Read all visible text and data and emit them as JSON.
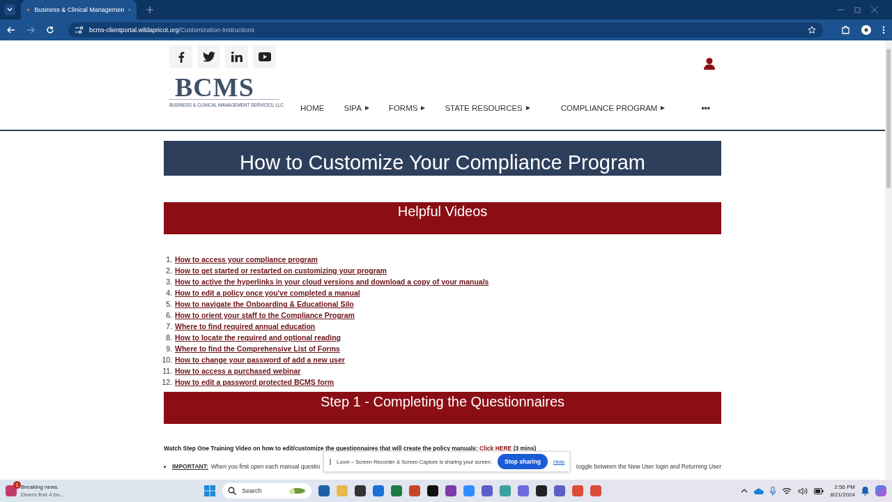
{
  "browser": {
    "tab_title": "Business & Clinical Managemen",
    "url_host": "bcms-clientportal.wildapricot.org",
    "url_path": "/Customization-Instructions"
  },
  "site": {
    "logo": "BCMS",
    "tagline": "BUSINESS & CLINICAL MANAGEMENT SERVICES, LLC",
    "nav": [
      {
        "label": "HOME",
        "submenu": false
      },
      {
        "label": "SIPA",
        "submenu": true
      },
      {
        "label": "FORMS",
        "submenu": true
      },
      {
        "label": "STATE RESOURCES",
        "submenu": true
      },
      {
        "label": "COMPLIANCE PROGRAM",
        "submenu": true
      }
    ],
    "more": "•••"
  },
  "page_title": "How to Customize Your Compliance Program",
  "videos": {
    "heading": "Helpful Videos",
    "items": [
      {
        "number": "1.",
        "title": "How to access your compliance program"
      },
      {
        "number": "2.",
        "title": "How to get started or restarted on customizing your program"
      },
      {
        "number": "3.",
        "title": "How to active the hyperlinks in your cloud versions and download a copy of your manuals"
      },
      {
        "number": "4.",
        "title": "How to edit a policy once you've completed a manual"
      },
      {
        "number": "5.",
        "title": "How to navigate the Onboarding & Educational Silo"
      },
      {
        "number": "6.",
        "title": "How to orient your staff to the Compliance Program"
      },
      {
        "number": "7.",
        "title": "Where to find required annual education"
      },
      {
        "number": "8.",
        "title": "How to locate the required and optional reading"
      },
      {
        "number": "9.",
        "title": "Where to find the Comprehensive List of Forms"
      },
      {
        "number": "10.",
        "title": "How to change your password of add a new user"
      },
      {
        "number": "11.",
        "title": "How to access a purchased webinar"
      },
      {
        "number": "12.",
        "title": "How to edit a password protected BCMS form"
      }
    ]
  },
  "step1": {
    "heading": "Step 1 - Completing the Questionnaires",
    "intro": "Watch Step One Training Video on how to edit/customize the questionnaires that will create the policy manuals:",
    "link": "Click HERE",
    "suffix": "(3 mins)",
    "bullet": {
      "label": "IMPORTANT:",
      "text_before": "When you first open each manual questio",
      "text_after": "toggle between the New User login and Returning User"
    }
  },
  "share_banner": {
    "message": "Loom – Screen Recorder & Screen Capture is sharing your screen.",
    "button": "Stop sharing",
    "link": "Hide"
  },
  "taskbar": {
    "news_badge": "1",
    "news_title": "Breaking news",
    "news_text": "Divers find 4 bo...",
    "search": "Search",
    "time": "2:56 PM",
    "date": "8/21/2024"
  }
}
